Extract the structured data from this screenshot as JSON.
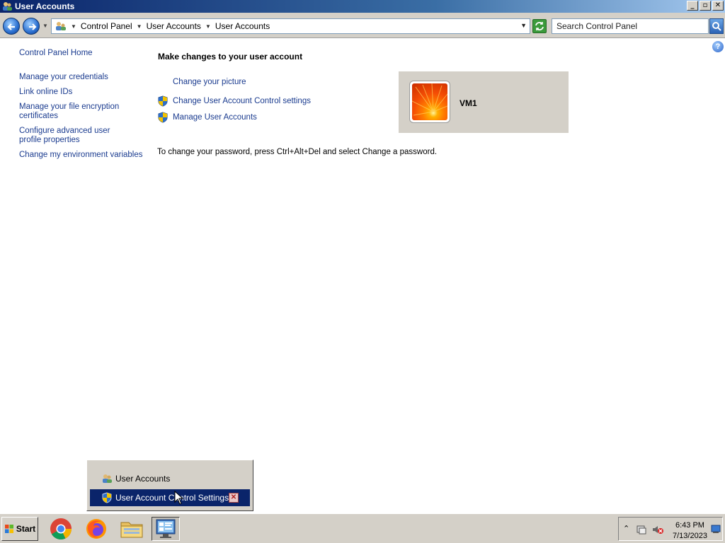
{
  "window": {
    "title": "User Accounts"
  },
  "address": {
    "crumbs": [
      "Control Panel",
      "User Accounts",
      "User Accounts"
    ],
    "search_placeholder": "Search Control Panel"
  },
  "left_pane": {
    "home": "Control Panel Home",
    "tasks": [
      "Manage your credentials",
      "Link online IDs",
      "Manage your file encryption certificates",
      "Configure advanced user profile properties",
      "Change my environment variables"
    ]
  },
  "main": {
    "heading": "Make changes to your user account",
    "tasks": [
      {
        "label": "Change your picture",
        "icon": "none"
      },
      {
        "label": "Change User Account Control settings",
        "icon": "uac-shield-icon"
      },
      {
        "label": "Manage User Accounts",
        "icon": "uac-shield-icon"
      }
    ],
    "username": "VM1",
    "password_hint": "To change your password, press Ctrl+Alt+Del and select Change a password."
  },
  "taskbar_popup": {
    "items": [
      "User Accounts",
      "User Account Control Settings"
    ],
    "selected_index": 1
  },
  "taskbar": {
    "start_label": "Start",
    "apps": [
      "chrome-icon",
      "firefox-icon",
      "file-explorer-icon",
      "control-panel-icon"
    ],
    "clock_time": "6:43 PM",
    "clock_date": "7/13/2023"
  },
  "colors": {
    "link": "#1a3b8f",
    "titlebar": "#0a246a",
    "chrome": "#d4d0c8"
  }
}
